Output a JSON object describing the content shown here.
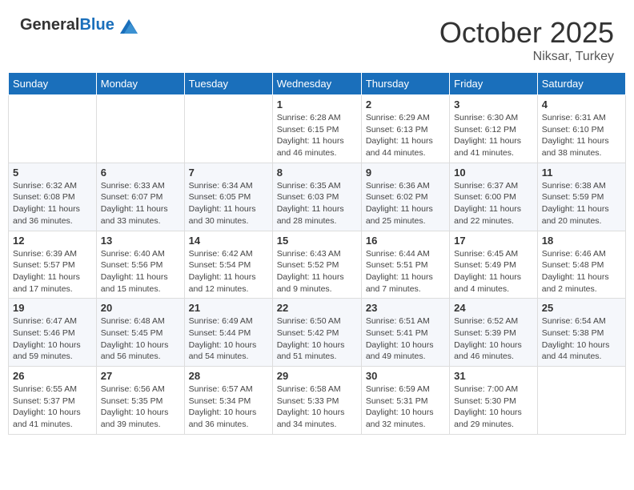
{
  "header": {
    "logo_general": "General",
    "logo_blue": "Blue",
    "month_title": "October 2025",
    "location": "Niksar, Turkey"
  },
  "days_of_week": [
    "Sunday",
    "Monday",
    "Tuesday",
    "Wednesday",
    "Thursday",
    "Friday",
    "Saturday"
  ],
  "weeks": [
    [
      {
        "day": "",
        "info": ""
      },
      {
        "day": "",
        "info": ""
      },
      {
        "day": "",
        "info": ""
      },
      {
        "day": "1",
        "info": "Sunrise: 6:28 AM\nSunset: 6:15 PM\nDaylight: 11 hours and 46 minutes."
      },
      {
        "day": "2",
        "info": "Sunrise: 6:29 AM\nSunset: 6:13 PM\nDaylight: 11 hours and 44 minutes."
      },
      {
        "day": "3",
        "info": "Sunrise: 6:30 AM\nSunset: 6:12 PM\nDaylight: 11 hours and 41 minutes."
      },
      {
        "day": "4",
        "info": "Sunrise: 6:31 AM\nSunset: 6:10 PM\nDaylight: 11 hours and 38 minutes."
      }
    ],
    [
      {
        "day": "5",
        "info": "Sunrise: 6:32 AM\nSunset: 6:08 PM\nDaylight: 11 hours and 36 minutes."
      },
      {
        "day": "6",
        "info": "Sunrise: 6:33 AM\nSunset: 6:07 PM\nDaylight: 11 hours and 33 minutes."
      },
      {
        "day": "7",
        "info": "Sunrise: 6:34 AM\nSunset: 6:05 PM\nDaylight: 11 hours and 30 minutes."
      },
      {
        "day": "8",
        "info": "Sunrise: 6:35 AM\nSunset: 6:03 PM\nDaylight: 11 hours and 28 minutes."
      },
      {
        "day": "9",
        "info": "Sunrise: 6:36 AM\nSunset: 6:02 PM\nDaylight: 11 hours and 25 minutes."
      },
      {
        "day": "10",
        "info": "Sunrise: 6:37 AM\nSunset: 6:00 PM\nDaylight: 11 hours and 22 minutes."
      },
      {
        "day": "11",
        "info": "Sunrise: 6:38 AM\nSunset: 5:59 PM\nDaylight: 11 hours and 20 minutes."
      }
    ],
    [
      {
        "day": "12",
        "info": "Sunrise: 6:39 AM\nSunset: 5:57 PM\nDaylight: 11 hours and 17 minutes."
      },
      {
        "day": "13",
        "info": "Sunrise: 6:40 AM\nSunset: 5:56 PM\nDaylight: 11 hours and 15 minutes."
      },
      {
        "day": "14",
        "info": "Sunrise: 6:42 AM\nSunset: 5:54 PM\nDaylight: 11 hours and 12 minutes."
      },
      {
        "day": "15",
        "info": "Sunrise: 6:43 AM\nSunset: 5:52 PM\nDaylight: 11 hours and 9 minutes."
      },
      {
        "day": "16",
        "info": "Sunrise: 6:44 AM\nSunset: 5:51 PM\nDaylight: 11 hours and 7 minutes."
      },
      {
        "day": "17",
        "info": "Sunrise: 6:45 AM\nSunset: 5:49 PM\nDaylight: 11 hours and 4 minutes."
      },
      {
        "day": "18",
        "info": "Sunrise: 6:46 AM\nSunset: 5:48 PM\nDaylight: 11 hours and 2 minutes."
      }
    ],
    [
      {
        "day": "19",
        "info": "Sunrise: 6:47 AM\nSunset: 5:46 PM\nDaylight: 10 hours and 59 minutes."
      },
      {
        "day": "20",
        "info": "Sunrise: 6:48 AM\nSunset: 5:45 PM\nDaylight: 10 hours and 56 minutes."
      },
      {
        "day": "21",
        "info": "Sunrise: 6:49 AM\nSunset: 5:44 PM\nDaylight: 10 hours and 54 minutes."
      },
      {
        "day": "22",
        "info": "Sunrise: 6:50 AM\nSunset: 5:42 PM\nDaylight: 10 hours and 51 minutes."
      },
      {
        "day": "23",
        "info": "Sunrise: 6:51 AM\nSunset: 5:41 PM\nDaylight: 10 hours and 49 minutes."
      },
      {
        "day": "24",
        "info": "Sunrise: 6:52 AM\nSunset: 5:39 PM\nDaylight: 10 hours and 46 minutes."
      },
      {
        "day": "25",
        "info": "Sunrise: 6:54 AM\nSunset: 5:38 PM\nDaylight: 10 hours and 44 minutes."
      }
    ],
    [
      {
        "day": "26",
        "info": "Sunrise: 6:55 AM\nSunset: 5:37 PM\nDaylight: 10 hours and 41 minutes."
      },
      {
        "day": "27",
        "info": "Sunrise: 6:56 AM\nSunset: 5:35 PM\nDaylight: 10 hours and 39 minutes."
      },
      {
        "day": "28",
        "info": "Sunrise: 6:57 AM\nSunset: 5:34 PM\nDaylight: 10 hours and 36 minutes."
      },
      {
        "day": "29",
        "info": "Sunrise: 6:58 AM\nSunset: 5:33 PM\nDaylight: 10 hours and 34 minutes."
      },
      {
        "day": "30",
        "info": "Sunrise: 6:59 AM\nSunset: 5:31 PM\nDaylight: 10 hours and 32 minutes."
      },
      {
        "day": "31",
        "info": "Sunrise: 7:00 AM\nSunset: 5:30 PM\nDaylight: 10 hours and 29 minutes."
      },
      {
        "day": "",
        "info": ""
      }
    ]
  ]
}
